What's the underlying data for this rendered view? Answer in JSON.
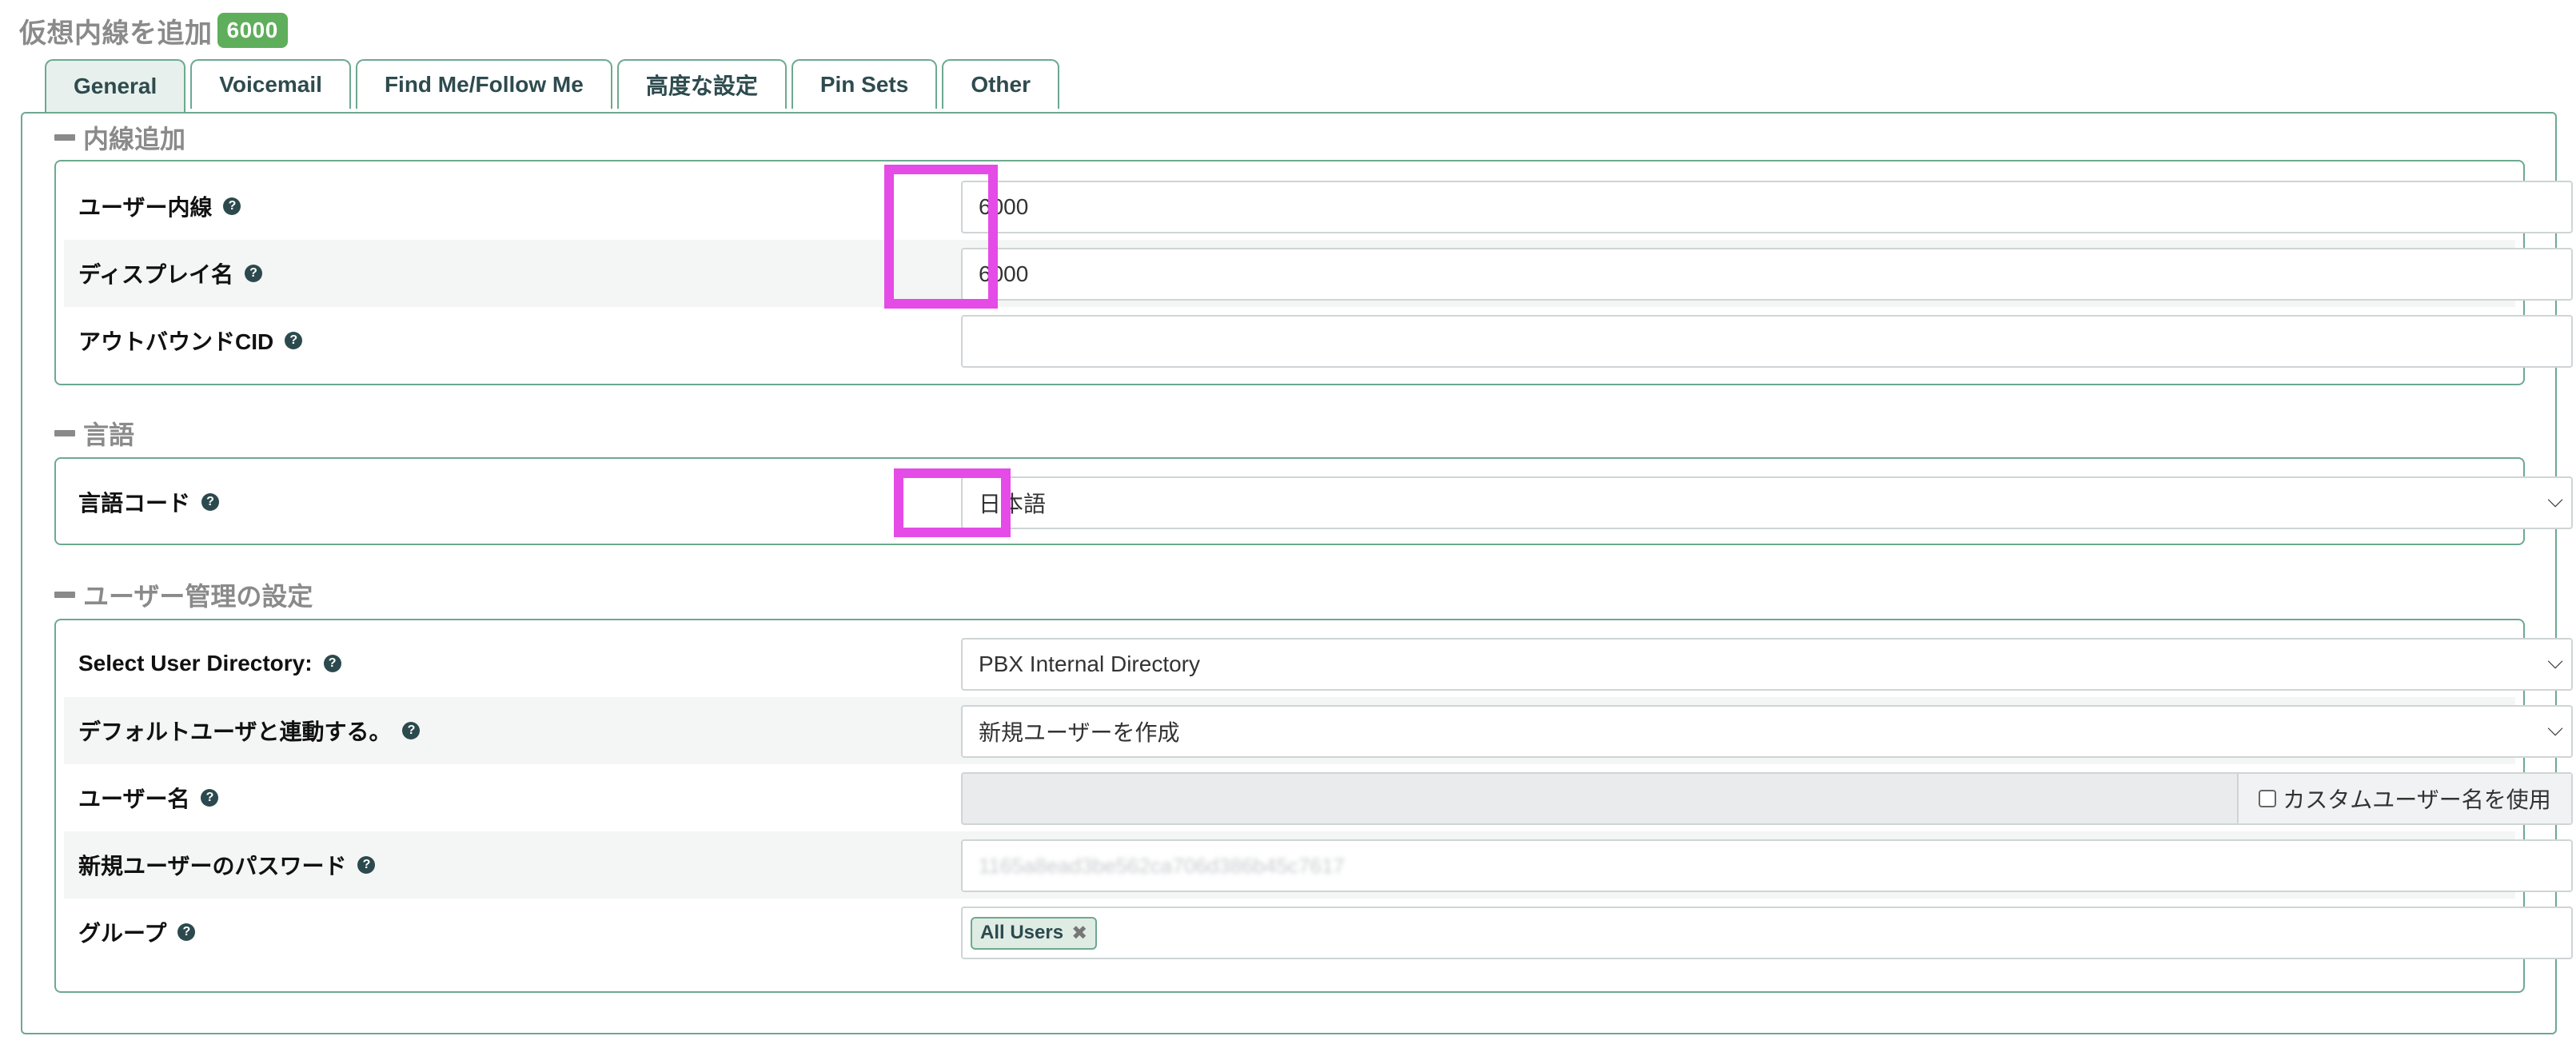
{
  "page": {
    "title": "仮想内線を追加",
    "extension_badge": "6000"
  },
  "tabs": [
    {
      "label": "General",
      "active": true
    },
    {
      "label": "Voicemail"
    },
    {
      "label": "Find Me/Follow Me"
    },
    {
      "label": "高度な設定"
    },
    {
      "label": "Pin Sets"
    },
    {
      "label": "Other"
    }
  ],
  "sections": {
    "add_extension": {
      "title": "内線追加",
      "fields": {
        "user_extension": {
          "label": "ユーザー内線",
          "value": "6000"
        },
        "display_name": {
          "label": "ディスプレイ名",
          "value": "6000"
        },
        "outbound_cid": {
          "label": "アウトバウンドCID",
          "value": ""
        }
      }
    },
    "language": {
      "title": "言語",
      "fields": {
        "language_code": {
          "label": "言語コード",
          "value": "日本語"
        }
      }
    },
    "user_management": {
      "title": "ユーザー管理の設定",
      "fields": {
        "user_directory": {
          "label": "Select User Directory:",
          "value": "PBX Internal Directory"
        },
        "link_default_user": {
          "label": "デフォルトユーザと連動する。",
          "value": "新規ユーザーを作成"
        },
        "username": {
          "label": "ユーザー名",
          "value": "",
          "custom_checkbox_label": "カスタムユーザー名を使用"
        },
        "new_user_password": {
          "label": "新規ユーザーのパスワード",
          "value": "1165a8ead3be562ca706d386b45c7617"
        },
        "groups": {
          "label": "グループ",
          "chips": [
            "All Users"
          ]
        }
      }
    }
  },
  "icons": {
    "help": "question-circle-icon",
    "chip_remove": "close-icon",
    "select": "chevron-down-icon"
  },
  "colors": {
    "accent": "#6da990",
    "badge": "#5fae5b",
    "highlight": "#e54be6",
    "tab_text": "#2e4b4f"
  }
}
